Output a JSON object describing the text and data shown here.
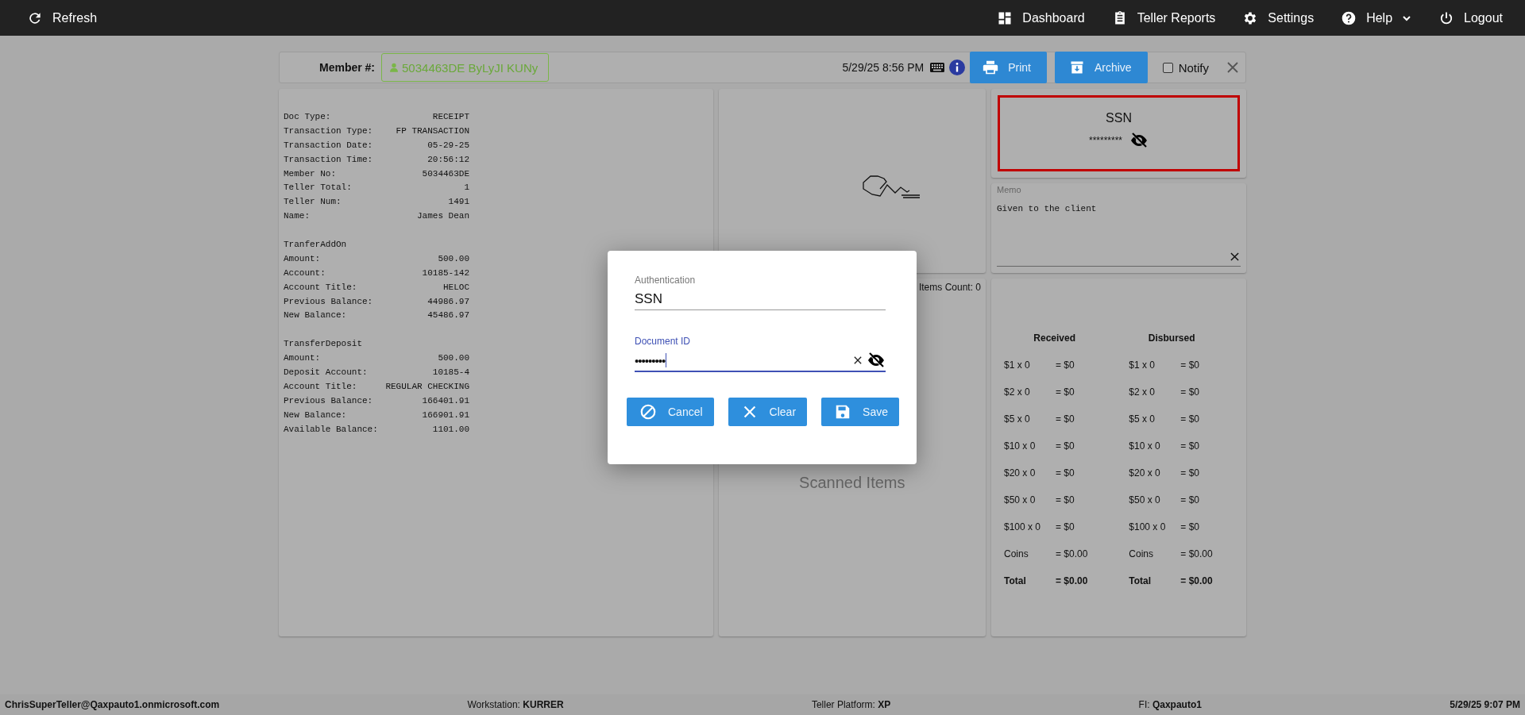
{
  "topbar": {
    "left": [
      {
        "label": "Refresh",
        "dropdown": false
      }
    ],
    "right": [
      {
        "label": "Dashboard",
        "dropdown": false
      },
      {
        "label": "Teller Reports",
        "dropdown": false
      },
      {
        "label": "Settings",
        "dropdown": false
      },
      {
        "label": "Help",
        "dropdown": true
      },
      {
        "label": "Logout",
        "dropdown": false
      }
    ]
  },
  "member_bar": {
    "label": "Member #:",
    "member": "5034463DE ByLyJI KUNy",
    "datetime": "5/29/25 8:56 PM",
    "buttons": [
      "Print",
      "Archive"
    ],
    "notify": {
      "label": "Notify",
      "checked": false
    }
  },
  "receipt": {
    "sections": [
      {
        "rows": [
          {
            "label": "Doc Type:",
            "value": "RECEIPT"
          },
          {
            "label": "Transaction Type:",
            "value": "FP TRANSACTION"
          },
          {
            "label": "Transaction Date:",
            "value": "05-29-25"
          },
          {
            "label": "Transaction Time:",
            "value": "20:56:12"
          },
          {
            "label": "Member No:",
            "value": "5034463DE"
          },
          {
            "label": "Teller Total:",
            "value": "1"
          },
          {
            "label": "Teller Num:",
            "value": "1491"
          },
          {
            "label": "Name:",
            "value": "James Dean"
          }
        ]
      },
      {
        "heading": "TranferAddOn",
        "rows": [
          {
            "label": "Amount:",
            "value": "500.00"
          },
          {
            "label": "Account:",
            "value": "10185-142"
          },
          {
            "label": "Account Title:",
            "value": "HELOC"
          },
          {
            "label": "Previous Balance:",
            "value": "44986.97"
          },
          {
            "label": "New Balance:",
            "value": "45486.97"
          }
        ]
      },
      {
        "heading": "TransferDeposit",
        "rows": [
          {
            "label": "Amount:",
            "value": "500.00"
          },
          {
            "label": "Deposit Account:",
            "value": "10185-4"
          },
          {
            "label": "Account Title:",
            "value": "REGULAR CHECKING"
          },
          {
            "label": "Previous Balance:",
            "value": "166401.91"
          },
          {
            "label": "New Balance:",
            "value": "166901.91"
          },
          {
            "label": "Available Balance:",
            "value": "1101.00"
          }
        ]
      }
    ]
  },
  "scanned": {
    "count": "Items Count: 0",
    "title": "Scanned Items"
  },
  "ssn_card": {
    "title": "SSN",
    "value": "*********",
    "alert": true
  },
  "memo": {
    "label": "Memo",
    "value": "Given to the client"
  },
  "cash": {
    "columns": [
      {
        "title": "Received",
        "rows": [
          {
            "kind": "line",
            "item": "$1 x 0",
            "amount": "= $0"
          },
          {
            "kind": "line",
            "item": "$2 x 0",
            "amount": "= $0"
          },
          {
            "kind": "line",
            "item": "$5 x 0",
            "amount": "= $0"
          },
          {
            "kind": "line",
            "item": "$10 x 0",
            "amount": "= $0"
          },
          {
            "kind": "line",
            "item": "$20 x 0",
            "amount": "= $0"
          },
          {
            "kind": "line",
            "item": "$50 x 0",
            "amount": "= $0"
          },
          {
            "kind": "line",
            "item": "$100 x 0",
            "amount": "= $0"
          },
          {
            "kind": "line",
            "item": "Coins",
            "amount": "= $0.00"
          },
          {
            "kind": "total",
            "item": "Total",
            "amount": "= $0.00"
          }
        ]
      },
      {
        "title": "Disbursed",
        "rows": [
          {
            "kind": "line",
            "item": "$1 x 0",
            "amount": "= $0"
          },
          {
            "kind": "line",
            "item": "$2 x 0",
            "amount": "= $0"
          },
          {
            "kind": "line",
            "item": "$5 x 0",
            "amount": "= $0"
          },
          {
            "kind": "line",
            "item": "$10 x 0",
            "amount": "= $0"
          },
          {
            "kind": "line",
            "item": "$20 x 0",
            "amount": "= $0"
          },
          {
            "kind": "line",
            "item": "$50 x 0",
            "amount": "= $0"
          },
          {
            "kind": "line",
            "item": "$100 x 0",
            "amount": "= $0"
          },
          {
            "kind": "line",
            "item": "Coins",
            "amount": "= $0.00"
          },
          {
            "kind": "total",
            "item": "Total",
            "amount": "= $0.00"
          }
        ]
      }
    ]
  },
  "dialog": {
    "fields": [
      {
        "label": "Authentication",
        "value": "SSN",
        "focused": false,
        "secret": false
      },
      {
        "label": "Document ID",
        "value": "•••••••••",
        "focused": true,
        "secret": true
      }
    ],
    "buttons": [
      "Cancel",
      "Clear",
      "Save"
    ]
  },
  "status_bar": [
    "**ChrisSuperTeller@Qaxpauto1.onmicrosoft.com**",
    "Workstation: **KURRER**",
    "Teller Platform: **XP**",
    "FI: **Qaxpauto1**",
    "**5/29/25 9:07 PM**"
  ]
}
